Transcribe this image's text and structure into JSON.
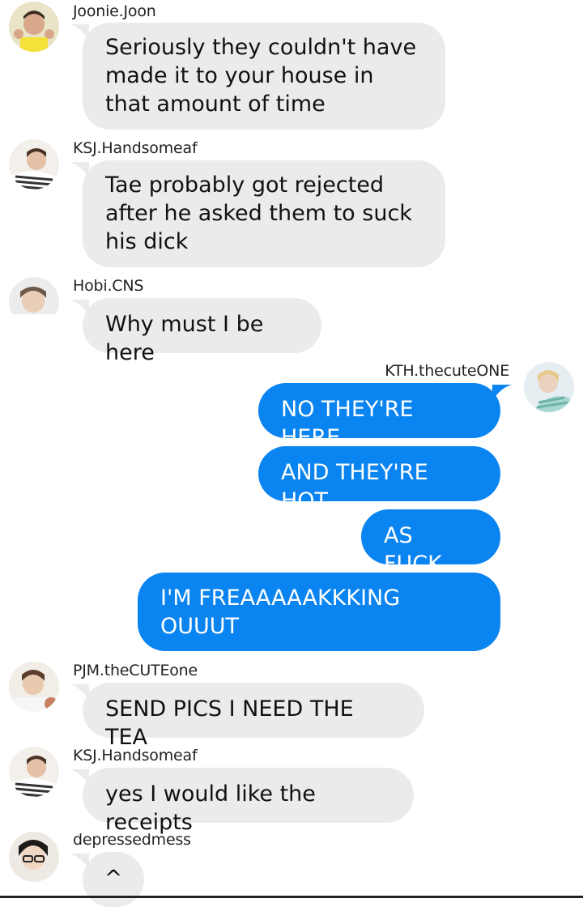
{
  "messages": [
    {
      "sender": "Joonie.Joon",
      "text": "Seriously they couldn't have made it to your house in that amount of time"
    },
    {
      "sender": "KSJ.Handsomeaf",
      "text": "Tae probably got rejected after he asked them to suck his dick"
    },
    {
      "sender": "Hobi.CNS",
      "text": "Why must I be here"
    },
    {
      "sender": "KTH.thecuteONE",
      "texts": [
        "NO THEY'RE HERE",
        "AND THEY'RE HOT",
        "AS FUCK",
        "I'M FREAAAAAKKKING OUUUT"
      ]
    },
    {
      "sender": "PJM.theCUTEone",
      "text": "SEND PICS I NEED THE TEA"
    },
    {
      "sender": "KSJ.Handsomeaf",
      "text": "yes I would like the receipts"
    },
    {
      "sender": "depressedmess",
      "text": "^"
    }
  ],
  "colors": {
    "incoming_bubble": "#ebebeb",
    "outgoing_bubble": "#0a84f0",
    "outgoing_text": "#ffffff"
  }
}
